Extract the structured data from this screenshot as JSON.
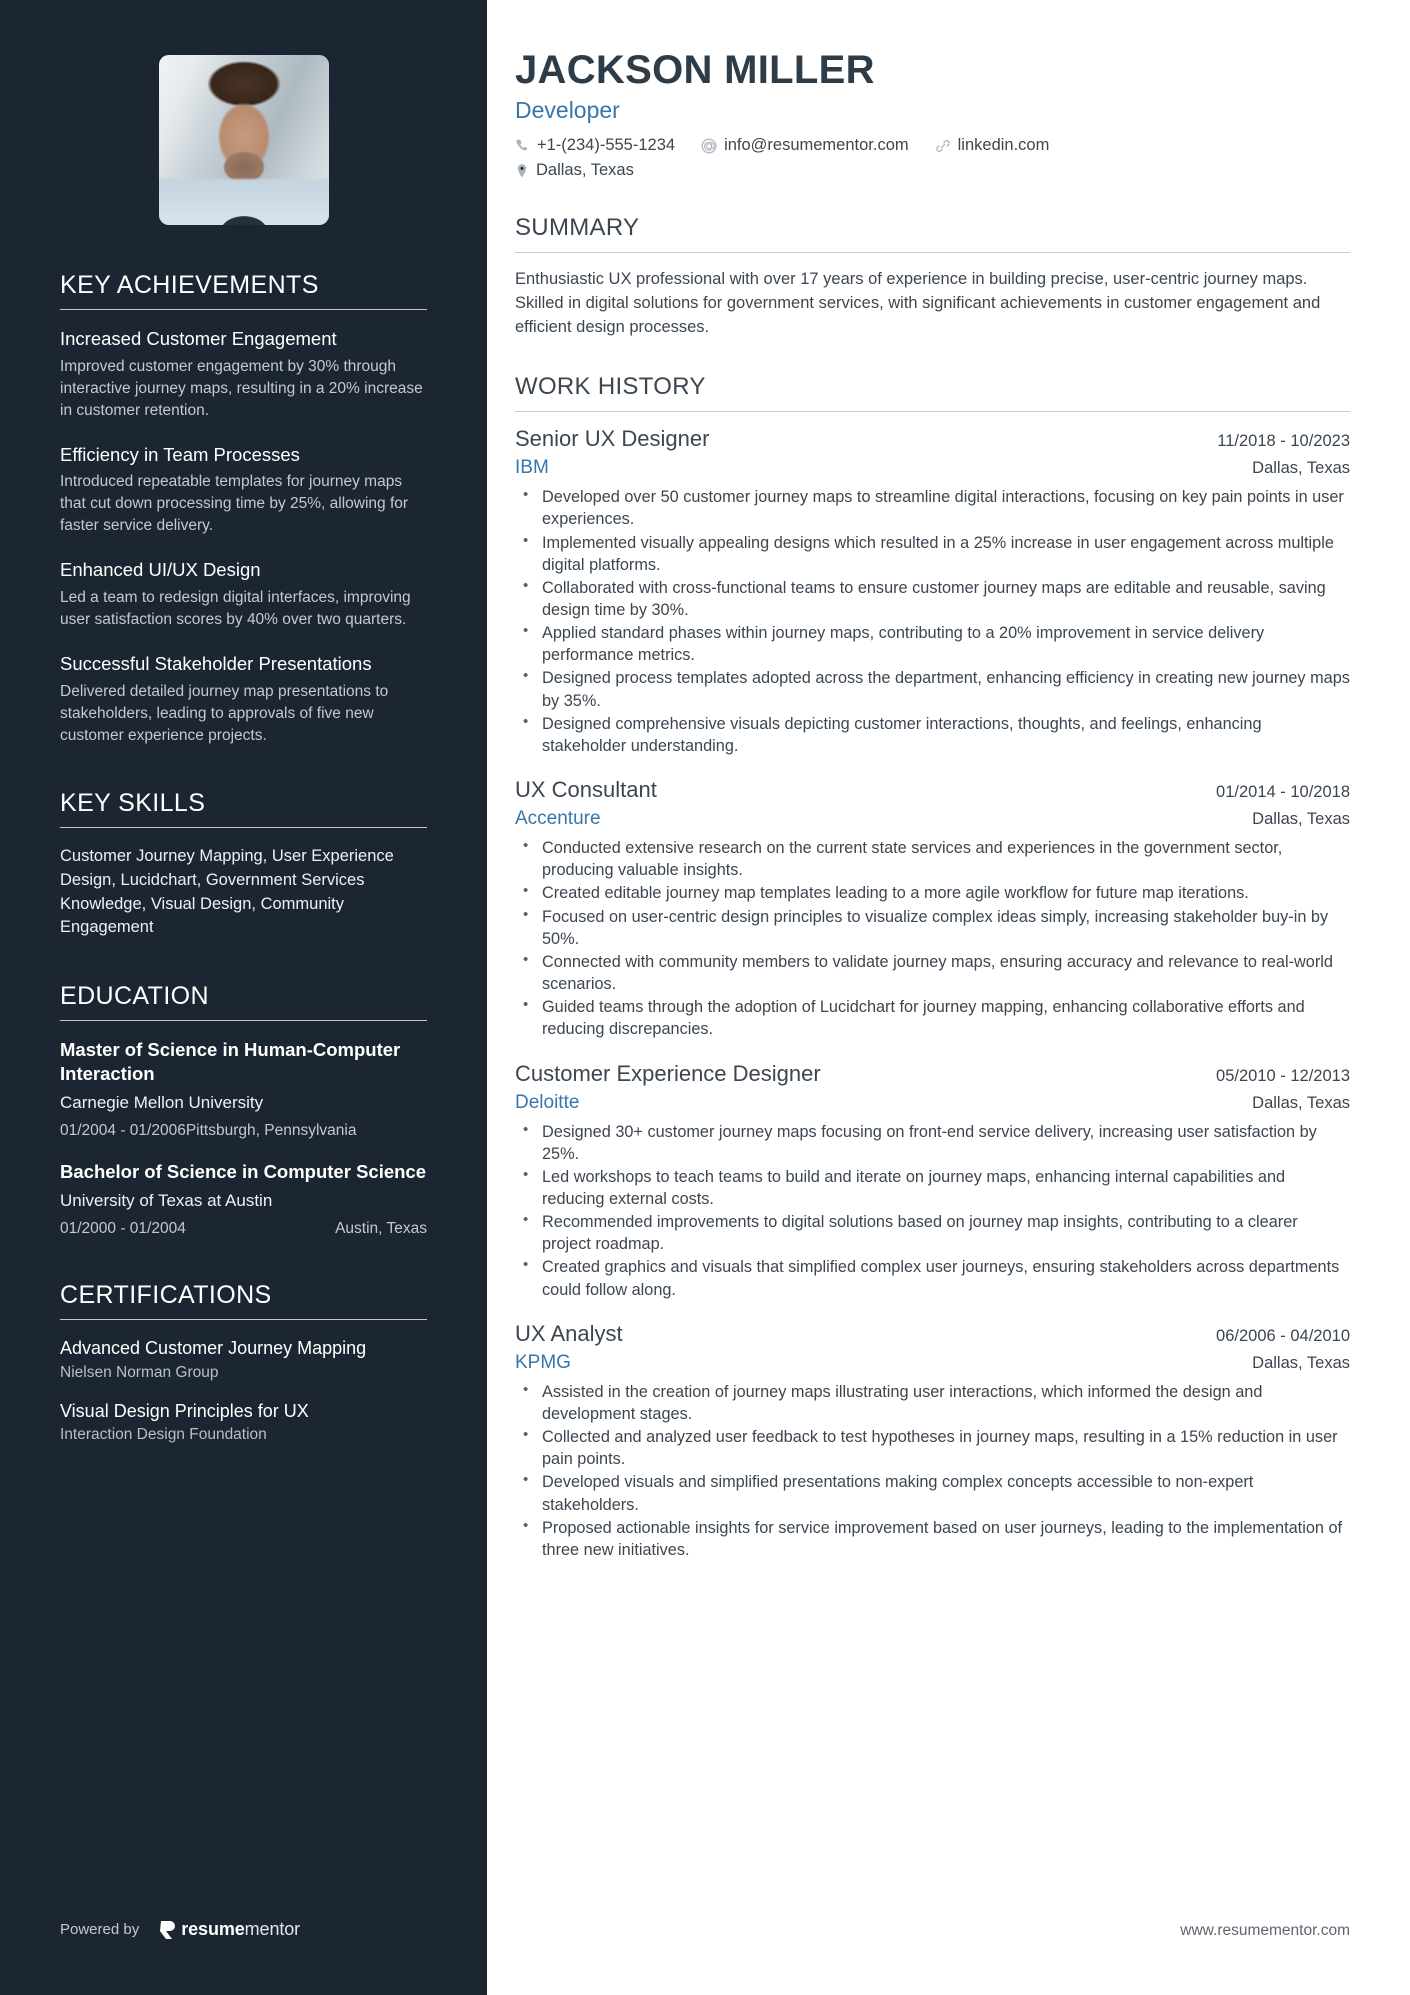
{
  "accent_color": "#3776ab",
  "sidebar_color": "#1c2632",
  "header": {
    "name": "JACKSON MILLER",
    "role": "Developer",
    "contacts": [
      {
        "icon": "phone-icon",
        "text": "+1-(234)-555-1234"
      },
      {
        "icon": "email-icon",
        "text": "info@resumementor.com"
      },
      {
        "icon": "link-icon",
        "text": "linkedin.com"
      },
      {
        "icon": "location-icon",
        "text": "Dallas, Texas"
      }
    ]
  },
  "sidebar": {
    "photo_alt": "profile-photo",
    "key_achievements": {
      "heading": "KEY ACHIEVEMENTS",
      "items": [
        {
          "title": "Increased Customer Engagement",
          "desc": "Improved customer engagement by 30% through interactive journey maps, resulting in a 20% increase in customer retention."
        },
        {
          "title": "Efficiency in Team Processes",
          "desc": "Introduced repeatable templates for journey maps that cut down processing time by 25%, allowing for faster service delivery."
        },
        {
          "title": "Enhanced UI/UX Design",
          "desc": "Led a team to redesign digital interfaces, improving user satisfaction scores by 40% over two quarters."
        },
        {
          "title": "Successful Stakeholder Presentations",
          "desc": "Delivered detailed journey map presentations to stakeholders, leading to approvals of five new customer experience projects."
        }
      ]
    },
    "key_skills": {
      "heading": "KEY SKILLS",
      "text": "Customer Journey Mapping, User Experience Design, Lucidchart, Government Services Knowledge, Visual Design, Community Engagement"
    },
    "education": {
      "heading": "EDUCATION",
      "items": [
        {
          "degree": "Master of Science in Human-Computer Interaction",
          "school": "Carnegie Mellon University",
          "dates": "01/2004 - 01/2006",
          "location": "Pittsburgh, Pennsylvania",
          "meta_stacked": true
        },
        {
          "degree": "Bachelor of Science in Computer Science",
          "school": "University of Texas at Austin",
          "dates": "01/2000 - 01/2004",
          "location": "Austin, Texas",
          "meta_stacked": false
        }
      ]
    },
    "certifications": {
      "heading": "CERTIFICATIONS",
      "items": [
        {
          "name": "Advanced Customer Journey Mapping",
          "issuer": "Nielsen Norman Group"
        },
        {
          "name": "Visual Design Principles for UX",
          "issuer": "Interaction Design Foundation"
        }
      ]
    },
    "powered_by_label": "Powered by",
    "brand_bold": "resume",
    "brand_light": "mentor"
  },
  "main": {
    "summary": {
      "heading": "SUMMARY",
      "text": "Enthusiastic UX professional with over 17 years of experience in building precise, user-centric journey maps. Skilled in digital solutions for government services, with significant achievements in customer engagement and efficient design processes."
    },
    "work_history": {
      "heading": "WORK HISTORY",
      "jobs": [
        {
          "title": "Senior UX Designer",
          "dates": "11/2018 - 10/2023",
          "company": "IBM",
          "location": "Dallas, Texas",
          "bullets": [
            "Developed over 50 customer journey maps to streamline digital interactions, focusing on key pain points in user experiences.",
            "Implemented visually appealing designs which resulted in a 25% increase in user engagement across multiple digital platforms.",
            "Collaborated with cross-functional teams to ensure customer journey maps are editable and reusable, saving design time by 30%.",
            "Applied standard phases within journey maps, contributing to a 20% improvement in service delivery performance metrics.",
            "Designed process templates adopted across the department, enhancing efficiency in creating new journey maps by 35%.",
            "Designed comprehensive visuals depicting customer interactions, thoughts, and feelings, enhancing stakeholder understanding."
          ]
        },
        {
          "title": "UX Consultant",
          "dates": "01/2014 - 10/2018",
          "company": "Accenture",
          "location": "Dallas, Texas",
          "bullets": [
            "Conducted extensive research on the current state services and experiences in the government sector, producing valuable insights.",
            "Created editable journey map templates leading to a more agile workflow for future map iterations.",
            "Focused on user-centric design principles to visualize complex ideas simply, increasing stakeholder buy-in by 50%.",
            "Connected with community members to validate journey maps, ensuring accuracy and relevance to real-world scenarios.",
            "Guided teams through the adoption of Lucidchart for journey mapping, enhancing collaborative efforts and reducing discrepancies."
          ]
        },
        {
          "title": "Customer Experience Designer",
          "dates": "05/2010 - 12/2013",
          "company": "Deloitte",
          "location": "Dallas, Texas",
          "bullets": [
            "Designed 30+ customer journey maps focusing on front-end service delivery, increasing user satisfaction by 25%.",
            "Led workshops to teach teams to build and iterate on journey maps, enhancing internal capabilities and reducing external costs.",
            "Recommended improvements to digital solutions based on journey map insights, contributing to a clearer project roadmap.",
            "Created graphics and visuals that simplified complex user journeys, ensuring stakeholders across departments could follow along."
          ]
        },
        {
          "title": "UX Analyst",
          "dates": "06/2006 - 04/2010",
          "company": "KPMG",
          "location": "Dallas, Texas",
          "bullets": [
            "Assisted in the creation of journey maps illustrating user interactions, which informed the design and development stages.",
            "Collected and analyzed user feedback to test hypotheses in journey maps, resulting in a 15% reduction in user pain points.",
            "Developed visuals and simplified presentations making complex concepts accessible to non-expert stakeholders.",
            "Proposed actionable insights for service improvement based on user journeys, leading to the implementation of three new initiatives."
          ]
        }
      ]
    },
    "footer_site": "www.resumementor.com"
  }
}
